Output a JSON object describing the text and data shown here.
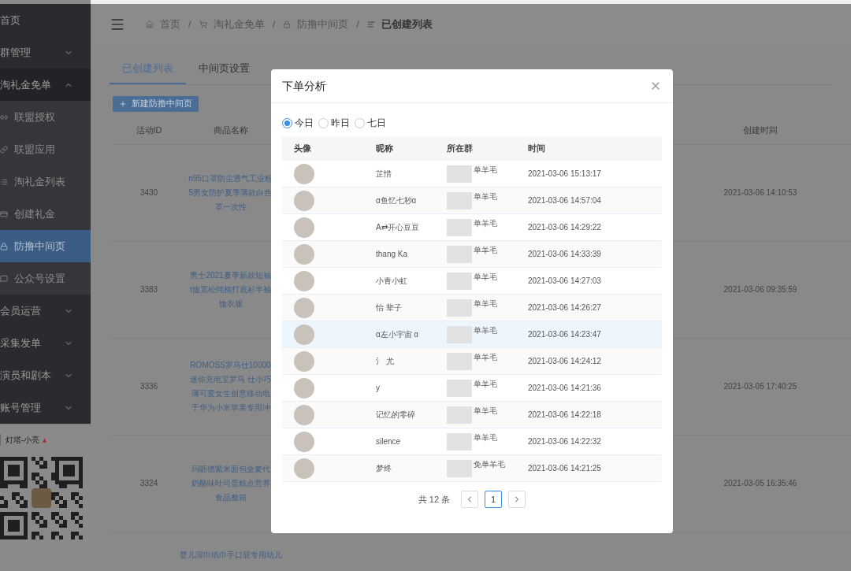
{
  "sidebar": {
    "items": [
      {
        "label": "首页",
        "kind": "link"
      },
      {
        "label": "群管理",
        "kind": "group",
        "expanded": false
      },
      {
        "label": "淘礼金免单",
        "kind": "group",
        "expanded": true,
        "children": [
          {
            "label": "联盟授权",
            "selected": false
          },
          {
            "label": "联盟应用",
            "selected": false
          },
          {
            "label": "淘礼金列表",
            "selected": false
          },
          {
            "label": "创建礼金",
            "selected": false
          },
          {
            "label": "防撸中间页",
            "selected": true
          },
          {
            "label": "公众号设置",
            "selected": false
          }
        ]
      },
      {
        "label": "会员运营",
        "kind": "group",
        "expanded": false
      },
      {
        "label": "采集发单",
        "kind": "group",
        "expanded": false
      },
      {
        "label": "演员和剧本",
        "kind": "group",
        "expanded": false
      },
      {
        "label": "账号管理",
        "kind": "group",
        "expanded": false
      }
    ],
    "contact": {
      "name": "灯塔-小亮"
    }
  },
  "breadcrumb": [
    "首页",
    "淘礼金免单",
    "防撸中间页",
    "已创建列表"
  ],
  "breadcrumb_separator": "/",
  "tabs": [
    {
      "label": "已创建列表",
      "selected": true
    },
    {
      "label": "中间页设置",
      "selected": false
    }
  ],
  "new_button": "新建防撸中间页",
  "table": {
    "columns": [
      "活动ID",
      "商品名称",
      "创建时间"
    ],
    "rows": [
      {
        "id": "3430",
        "product": [
          "n95口罩防尘透气工业粉",
          "5男女防护夏季薄款白色",
          "罩一次性"
        ],
        "created": "2021-03-06 14:10:53"
      },
      {
        "id": "3383",
        "product": [
          "男士2021夏季新款短袖",
          "t恤宽松纯棉打底衫半袖",
          "恤衣服"
        ],
        "created": "2021-03-06 09:35:59"
      },
      {
        "id": "3336",
        "product": [
          "ROMOSS罗马仕10000",
          "迷你充电宝罗马 仕小巧",
          "薄可爱女生创意移动电",
          "于华为小米苹果专用冲"
        ],
        "created": "2021-03-05 17:40:25"
      },
      {
        "id": "3324",
        "product": [
          "玛呖德紫米面包全麦代",
          "奶酪味吐司蛋糕点营养",
          "食品整箱"
        ],
        "created": "2021-03-05 16:35:46"
      },
      {
        "id": "",
        "product": [
          "婴儿湿巾纸巾手口屁专用幼儿"
        ],
        "created": ""
      }
    ]
  },
  "dialog": {
    "title": "下单分析",
    "ranges": [
      {
        "label": "今日",
        "selected": true
      },
      {
        "label": "昨日",
        "selected": false
      },
      {
        "label": "七日",
        "selected": false
      }
    ],
    "columns": [
      "头像",
      "昵称",
      "所在群",
      "时间"
    ],
    "rows": [
      {
        "nickname": "芷惜",
        "group": "单羊毛",
        "time": "2021-03-06 15:13:17",
        "highlighted": false
      },
      {
        "nickname": "ɑ鱼忆七秒ɑ",
        "group": "单羊毛",
        "time": "2021-03-06 14:57:04",
        "highlighted": false
      },
      {
        "nickname": "A⇄开心豆豆",
        "group": "单羊毛",
        "time": "2021-03-06 14:29:22",
        "highlighted": false
      },
      {
        "nickname": "thang Ka",
        "group": "单羊毛",
        "time": "2021-03-06 14:33:39",
        "highlighted": false
      },
      {
        "nickname": "小青小虹",
        "group": "单羊毛",
        "time": "2021-03-06 14:27:03",
        "highlighted": false
      },
      {
        "nickname": "怡 辈子",
        "group": "单羊毛",
        "time": "2021-03-06 14:26:27",
        "highlighted": false
      },
      {
        "nickname": "ɑ左小宇宙 ɑ",
        "group": "单羊毛",
        "time": "2021-03-06 14:23:47",
        "highlighted": true
      },
      {
        "nickname": "氵 尤",
        "group": "单羊毛",
        "time": "2021-03-06 14:24:12",
        "highlighted": false
      },
      {
        "nickname": "y",
        "group": "单羊毛",
        "time": "2021-03-06 14:21:36",
        "highlighted": false
      },
      {
        "nickname": "记忆的零碎",
        "group": "单羊毛",
        "time": "2021-03-06 14:22:18",
        "highlighted": false
      },
      {
        "nickname": "silence",
        "group": "单羊毛",
        "time": "2021-03-06 14:22:32",
        "highlighted": false
      },
      {
        "nickname": "梦终",
        "group": "免单羊毛",
        "time": "2021-03-06 14:21:25",
        "highlighted": false
      }
    ],
    "pagination": {
      "total": "共 12 条",
      "pages": [
        {
          "label": "1",
          "selected": true
        }
      ]
    }
  }
}
